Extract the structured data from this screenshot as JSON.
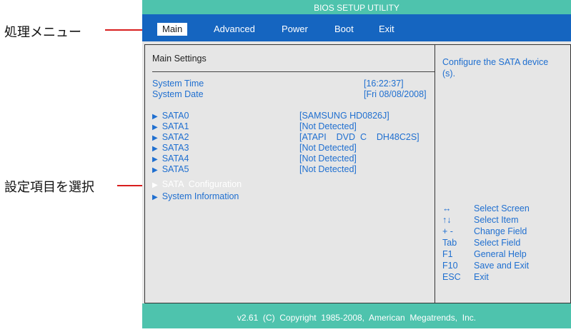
{
  "annotations": {
    "menu_label": "処理メニュー",
    "select_label": "設定項目を選択"
  },
  "title": "BIOS SETUP UTILITY",
  "menu": {
    "items": [
      "Main",
      "Advanced",
      "Power",
      "Boot",
      "Exit"
    ],
    "active": "Main"
  },
  "main": {
    "heading": "Main Settings",
    "system_time_label": "System Time",
    "system_time_value": "[16:22:37]",
    "system_date_label": "System Date",
    "system_date_value": "[Fri  08/08/2008]",
    "sata": [
      {
        "label": "SATA0",
        "value": "[SAMSUNG  HD0826J]"
      },
      {
        "label": "SATA1",
        "value": "[Not  Detected]"
      },
      {
        "label": "SATA2",
        "value": "[ATAPI    DVD  C    DH48C2S]"
      },
      {
        "label": "SATA3",
        "value": "[Not  Detected]"
      },
      {
        "label": "SATA4",
        "value": "[Not  Detected]"
      },
      {
        "label": "SATA5",
        "value": "[Not  Detected]"
      }
    ],
    "sata_config": "SATA  Configuration",
    "system_info": "System Information"
  },
  "help": {
    "description": "Configure  the  SATA device (s).",
    "keys": [
      {
        "key": "↔",
        "desc": "Select Screen"
      },
      {
        "key": "↑↓",
        "desc": "Select Item"
      },
      {
        "key": "+ -",
        "desc": "Change Field"
      },
      {
        "key": "Tab",
        "desc": "Select Field"
      },
      {
        "key": "F1",
        "desc": "General Help"
      },
      {
        "key": "F10",
        "desc": "Save and Exit"
      },
      {
        "key": "ESC",
        "desc": "Exit"
      }
    ]
  },
  "footer": "v2.61  (C)  Copyright  1985-2008,  American  Megatrends,  Inc.",
  "colors": {
    "teal": "#4ec3ad",
    "menu_blue": "#1565c0",
    "panel_bg": "#e6e6e6",
    "text_blue": "#1f6fd0",
    "annotation_red": "#d81e1e"
  }
}
